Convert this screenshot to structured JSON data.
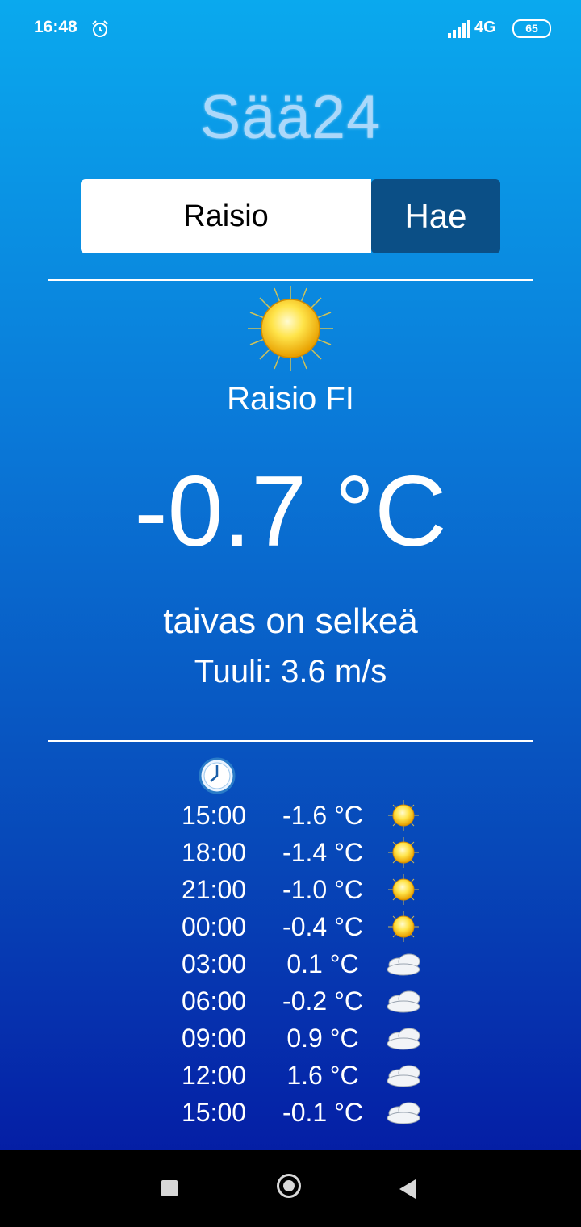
{
  "status_bar": {
    "time": "16:48",
    "network": "4G",
    "battery": "65"
  },
  "app": {
    "logo": "Sää24"
  },
  "search": {
    "value": "Raisio",
    "button_label": "Hae"
  },
  "current": {
    "location": "Raisio FI",
    "temperature": "-0.7 °C",
    "condition": "taivas on selkeä",
    "wind": "Tuuli: 3.6 m/s",
    "icon": "sun-icon"
  },
  "forecast": [
    {
      "time": "15:00",
      "temp": "-1.6 °C",
      "icon": "sun-icon"
    },
    {
      "time": "18:00",
      "temp": "-1.4 °C",
      "icon": "sun-icon"
    },
    {
      "time": "21:00",
      "temp": "-1.0 °C",
      "icon": "sun-icon"
    },
    {
      "time": "00:00",
      "temp": "-0.4 °C",
      "icon": "sun-icon"
    },
    {
      "time": "03:00",
      "temp": "0.1 °C",
      "icon": "cloud-icon"
    },
    {
      "time": "06:00",
      "temp": "-0.2 °C",
      "icon": "cloud-icon"
    },
    {
      "time": "09:00",
      "temp": "0.9 °C",
      "icon": "cloud-icon"
    },
    {
      "time": "12:00",
      "temp": "1.6 °C",
      "icon": "cloud-icon"
    },
    {
      "time": "15:00",
      "temp": "-0.1 °C",
      "icon": "cloud-icon"
    }
  ],
  "colors": {
    "button": "#0b4f86",
    "background_top": "#0aa9ee",
    "background_bottom": "#0414a0"
  }
}
